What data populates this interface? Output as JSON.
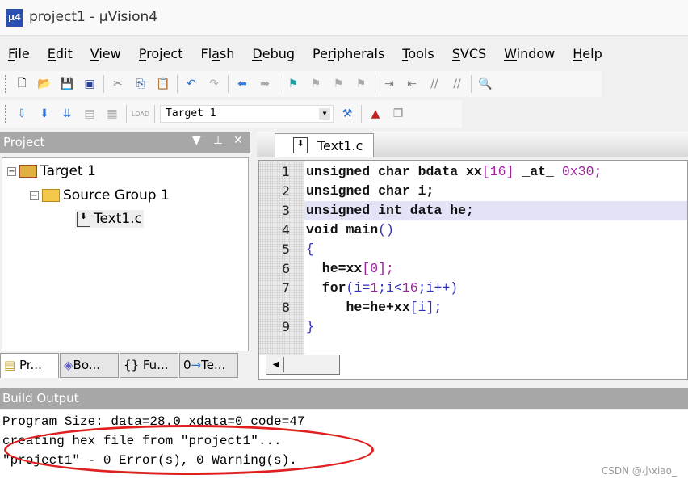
{
  "window": {
    "title": "project1  - µVision4",
    "icon": "uvision-logo-icon"
  },
  "menu": [
    "File",
    "Edit",
    "View",
    "Project",
    "Flash",
    "Debug",
    "Peripherals",
    "Tools",
    "SVCS",
    "Window",
    "Help"
  ],
  "menu_underline": [
    "F",
    "E",
    "V",
    "P",
    "a",
    "D",
    "r",
    "T",
    "S",
    "W",
    "H"
  ],
  "toolbar2": {
    "target": "Target 1"
  },
  "project_panel": {
    "title": "Project",
    "tree": {
      "target": "Target 1",
      "group": "Source Group 1",
      "file": "Text1.c"
    },
    "tabs": [
      "Pr...",
      "Bo...",
      "Fu...",
      "Te..."
    ]
  },
  "editor": {
    "tab": "Text1.c",
    "highlighted_line": 3,
    "lines": [
      [
        [
          "k",
          "unsigned char bdata xx"
        ],
        [
          "p",
          "[16]"
        ],
        [
          "k",
          " _at_ "
        ],
        [
          "p",
          "0x30;"
        ]
      ],
      [
        [
          "k",
          "unsigned char i;"
        ]
      ],
      [
        [
          "k",
          "unsigned int data he;"
        ]
      ],
      [
        [
          "k",
          "void main"
        ],
        [
          "b",
          "()"
        ]
      ],
      [
        [
          "b",
          "{"
        ]
      ],
      [
        [
          "k",
          "  he=xx"
        ],
        [
          "p",
          "[0];"
        ]
      ],
      [
        [
          "k",
          "  for"
        ],
        [
          "b",
          "(i="
        ],
        [
          "p",
          "1"
        ],
        [
          "b",
          ";i<"
        ],
        [
          "p",
          "16"
        ],
        [
          "b",
          ";i++)"
        ]
      ],
      [
        [
          "k",
          "     he=he+xx"
        ],
        [
          "b",
          "[i];"
        ]
      ],
      [
        [
          "b",
          "}"
        ]
      ]
    ]
  },
  "build_output": {
    "title": "Build Output",
    "lines": [
      "Program Size: data=28.0 xdata=0 code=47",
      "creating hex file from \"project1\"...",
      "\"project1\" - 0 Error(s), 0 Warning(s)."
    ]
  },
  "watermark": "CSDN @小xiao_",
  "colors": {
    "annotation": "#e02020",
    "line_highlight": "#e3e3f7",
    "literal": "#a020a0"
  }
}
